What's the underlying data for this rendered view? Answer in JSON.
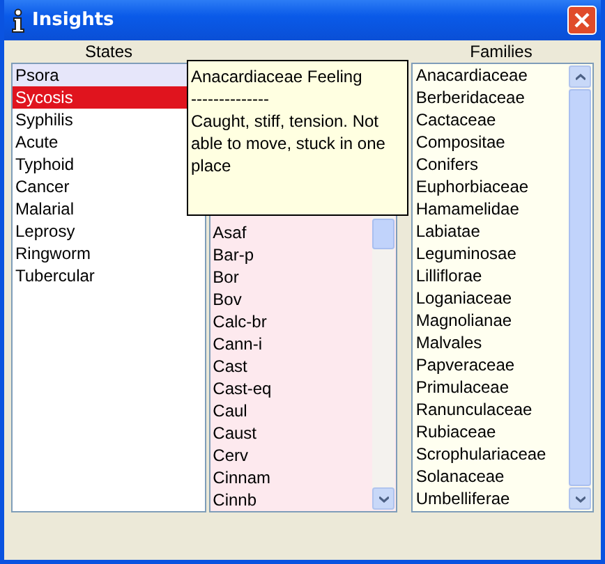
{
  "window": {
    "title": "Insights"
  },
  "states": {
    "header": "States",
    "items": [
      {
        "label": "Psora",
        "selected": false,
        "hovered": true
      },
      {
        "label": "Sycosis",
        "selected": true,
        "hovered": false
      },
      {
        "label": "Syphilis",
        "selected": false,
        "hovered": false
      },
      {
        "label": "Acute",
        "selected": false,
        "hovered": false
      },
      {
        "label": "Typhoid",
        "selected": false,
        "hovered": false
      },
      {
        "label": "Cancer",
        "selected": false,
        "hovered": false
      },
      {
        "label": "Malarial",
        "selected": false,
        "hovered": false
      },
      {
        "label": "Leprosy",
        "selected": false,
        "hovered": false
      },
      {
        "label": "Ringworm",
        "selected": false,
        "hovered": false
      },
      {
        "label": "Tubercular",
        "selected": false,
        "hovered": false
      }
    ]
  },
  "remedies": {
    "items": [
      "Asaf",
      "Bar-p",
      "Bor",
      "Bov",
      "Calc-br",
      "Cann-i",
      "Cast",
      "Cast-eq",
      "Caul",
      "Caust",
      "Cerv",
      "Cinnam",
      "Cinnb"
    ]
  },
  "families": {
    "header": "Families",
    "items": [
      "Anacardiaceae",
      "Berberidaceae",
      "Cactaceae",
      "Compositae",
      "Conifers",
      "Euphorbiaceae",
      "Hamamelidae",
      "Labiatae",
      "Leguminosae",
      "Lilliflorae",
      "Loganiaceae",
      "Magnolianae",
      "Malvales",
      "Papveraceae",
      "Primulaceae",
      "Ranunculaceae",
      "Rubiaceae",
      "Scrophulariaceae",
      "Solanaceae",
      "Umbelliferae"
    ]
  },
  "tooltip": {
    "title": "Anacardiaceae Feeling",
    "separator": "--------------",
    "text": "Caught, stiff, tension. Not able to move, stuck in one place"
  }
}
